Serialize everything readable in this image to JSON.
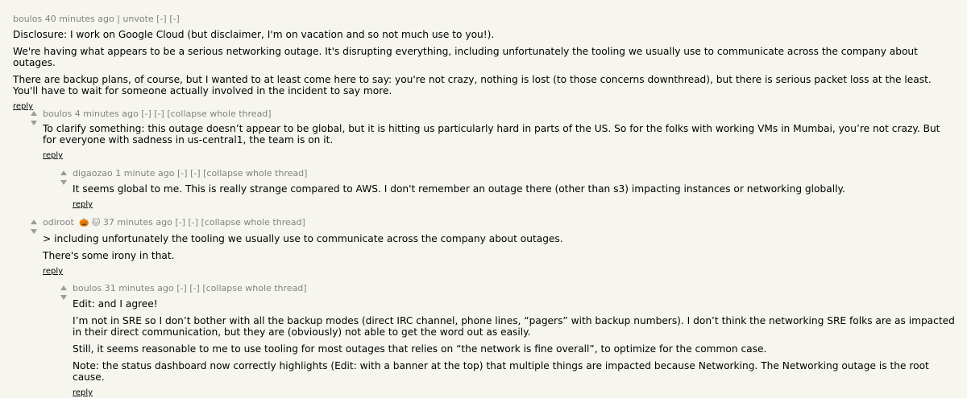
{
  "comments": [
    {
      "author": "boulos",
      "age": "40 minutes ago",
      "sep": "|",
      "unvote": "unvote",
      "toggle1": "[-]",
      "toggle2": "[-]",
      "paragraphs": [
        "Disclosure: I work on Google Cloud (but disclaimer, I'm on vacation and so not much use to you!).",
        "We're having what appears to be a serious networking outage. It's disrupting everything, including unfortunately the tooling we usually use to communicate across the company about outages.",
        "There are backup plans, of course, but I wanted to at least come here to say: you're not crazy, nothing is lost (to those concerns downthread), but there is serious packet loss at the least. You'll have to wait for someone actually involved in the incident to say more."
      ],
      "reply": "reply"
    },
    {
      "author": "boulos",
      "age": "4 minutes ago",
      "toggle1": "[-]",
      "toggle2": "[-]",
      "collapse": "[collapse whole thread]",
      "paragraphs": [
        "To clarify something: this outage doesn’t appear to be global, but it is hitting us particularly hard in parts of the US. So for the folks with working VMs in Mumbai, you’re not crazy. But for everyone with sadness in us-central1, the team is on it."
      ],
      "reply": "reply"
    },
    {
      "author": "digaozao",
      "age": "1 minute ago",
      "toggle1": "[-]",
      "toggle2": "[-]",
      "collapse": "[collapse whole thread]",
      "paragraphs": [
        "It seems global to me. This is really strange compared to AWS. I don't remember an outage there (other than s3) impacting instances or networking globally."
      ],
      "reply": "reply"
    },
    {
      "author": "odiroot",
      "badges": "🎃 🐱",
      "age": "37 minutes ago",
      "toggle1": "[-]",
      "toggle2": "[-]",
      "collapse": "[collapse whole thread]",
      "paragraphs": [
        "> including unfortunately the tooling we usually use to communicate across the company about outages.",
        "There's some irony in that."
      ],
      "reply": "reply"
    },
    {
      "author": "boulos",
      "age": "31 minutes ago",
      "toggle1": "[-]",
      "toggle2": "[-]",
      "collapse": "[collapse whole thread]",
      "paragraphs": [
        "Edit: and I agree!",
        "I’m not in SRE so I don’t bother with all the backup modes (direct IRC channel, phone lines, “pagers” with backup numbers). I don’t think the networking SRE folks are as impacted in their direct communication, but they are (obviously) not able to get the word out as easily.",
        "Still, it seems reasonable to me to use tooling for most outages that relies on “the network is fine overall”, to optimize for the common case.",
        "Note: the status dashboard now correctly highlights (Edit: with a banner at the top) that multiple things are impacted because Networking. The Networking outage is the root cause."
      ],
      "reply": "reply"
    }
  ]
}
